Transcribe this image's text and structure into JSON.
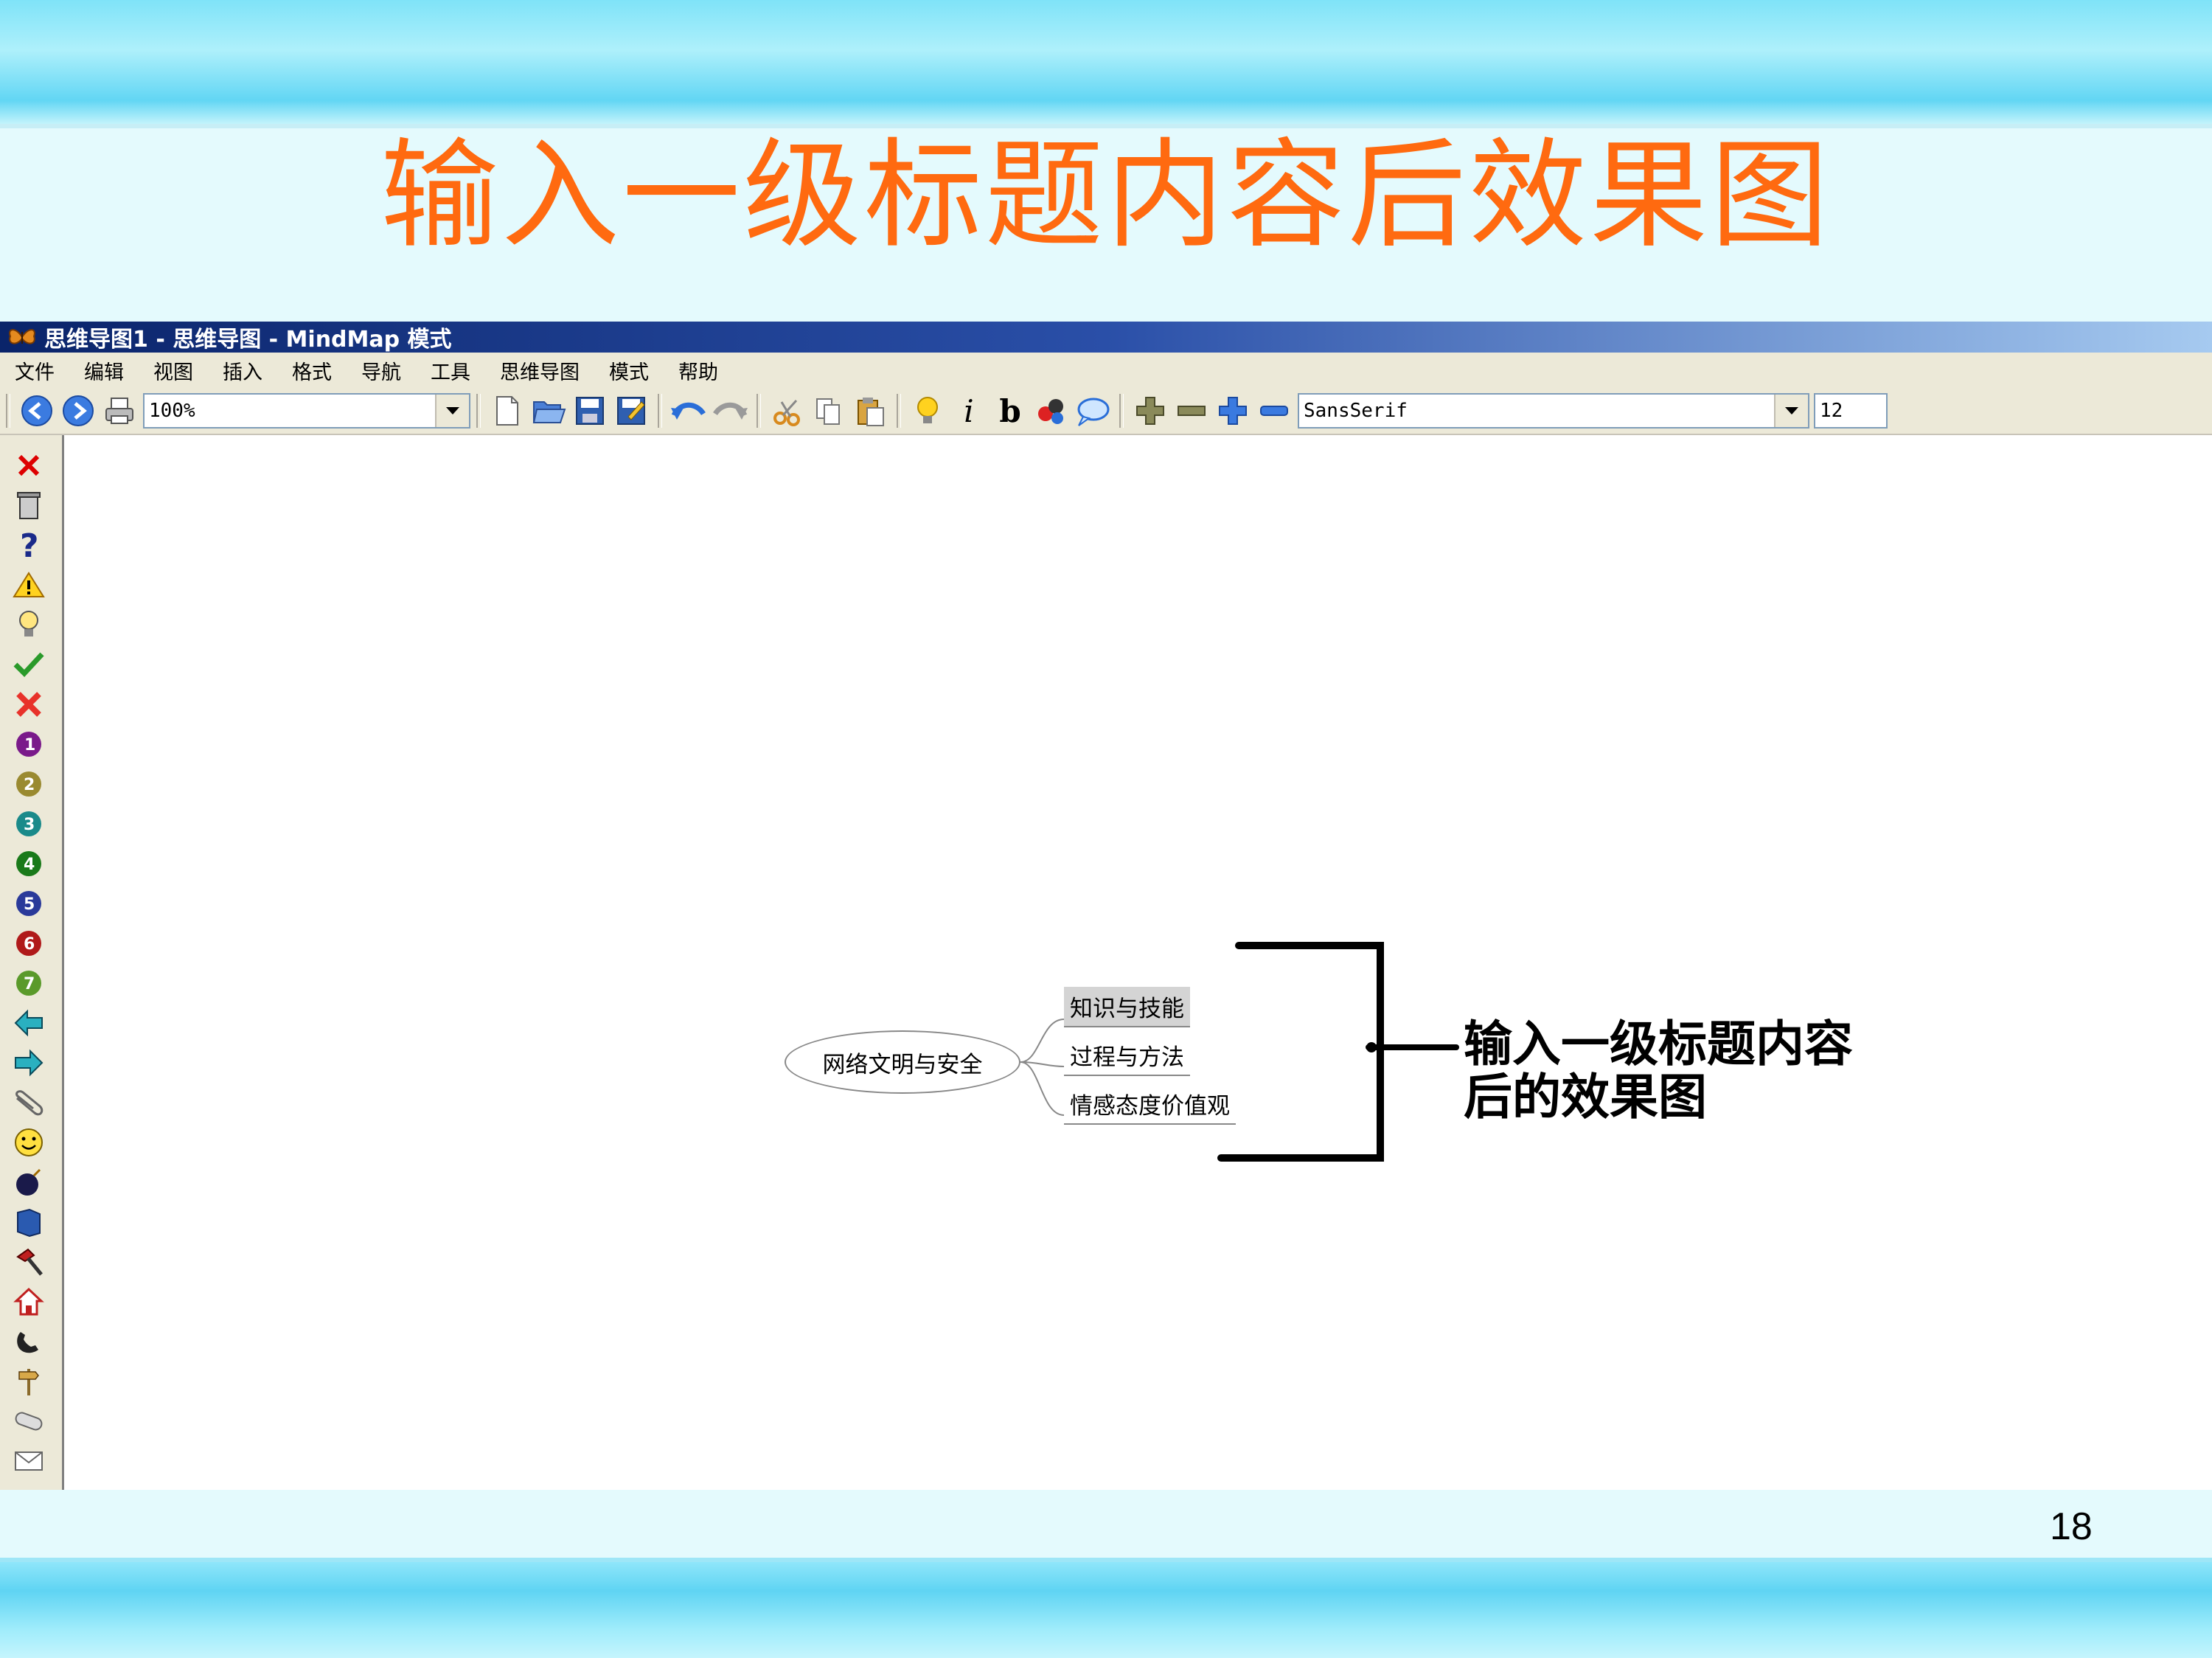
{
  "slide": {
    "title": "输入一级标题内容后效果图",
    "page_number": "18"
  },
  "window": {
    "title": "思维导图1 - 思维导图 - MindMap 模式"
  },
  "menu": {
    "items": [
      "文件",
      "编辑",
      "视图",
      "插入",
      "格式",
      "导航",
      "工具",
      "思维导图",
      "模式",
      "帮助"
    ]
  },
  "toolbar": {
    "zoom_value": "100%",
    "font_family_value": "SansSerif",
    "font_size_value": "12",
    "italic_label": "i",
    "bold_label": "b"
  },
  "icons": {
    "left_toolbar": [
      "delete-x-icon",
      "trash-icon",
      "question-icon",
      "warning-icon",
      "lightbulb-icon",
      "checkmark-icon",
      "red-x-icon",
      "priority-1-icon",
      "priority-2-icon",
      "priority-3-icon",
      "priority-4-icon",
      "priority-5-icon",
      "priority-6-icon",
      "priority-7-icon",
      "arrow-left-icon",
      "arrow-right-icon",
      "paperclip-icon",
      "smiley-icon",
      "bomb-icon",
      "book-icon",
      "hammer-icon",
      "home-icon",
      "phone-icon",
      "signpost-icon",
      "pill-icon",
      "envelope-icon"
    ]
  },
  "mindmap": {
    "root": "网络文明与安全",
    "children": [
      "知识与技能",
      "过程与方法",
      "情感态度价值观"
    ]
  },
  "annotation": {
    "text": "输入一级标题内容\n后的效果图"
  },
  "colors": {
    "title_orange": "#ff6a10",
    "titlebar_blue": "#0a246a",
    "slide_bg": "#e4fafd"
  }
}
